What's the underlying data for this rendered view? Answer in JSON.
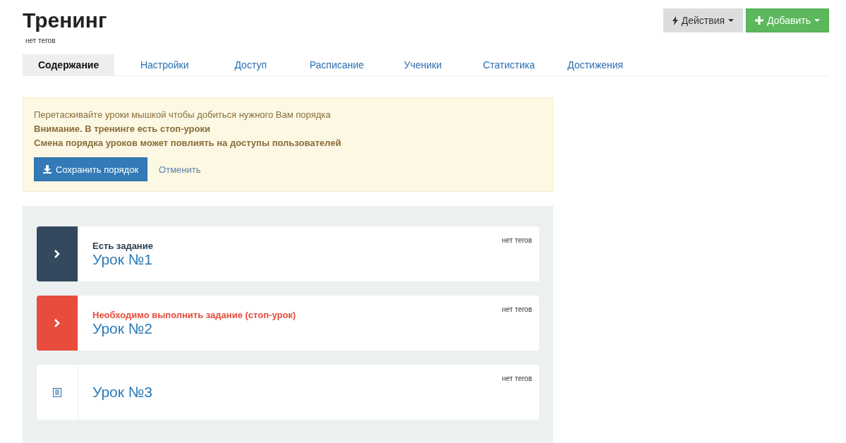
{
  "header": {
    "title": "Тренинг",
    "tags": "нет тегов",
    "actions": [
      {
        "kind": "actions",
        "label": "Действия"
      },
      {
        "kind": "add",
        "label": "Добавить"
      }
    ]
  },
  "tabs": [
    {
      "label": "Содержание",
      "selected": true
    },
    {
      "label": "Настройки",
      "selected": false
    },
    {
      "label": "Доступ",
      "selected": false
    },
    {
      "label": "Расписание",
      "selected": false
    },
    {
      "label": "Ученики",
      "selected": false
    },
    {
      "label": "Статистика",
      "selected": false
    },
    {
      "label": "Достижения",
      "selected": false
    }
  ],
  "notice": {
    "lines": [
      {
        "text": "Перетаскивайте уроки мышкой чтобы добиться нужного Вам порядка",
        "bold": false
      },
      {
        "text": "Внимание. В тренинге есть стоп-уроки",
        "bold": true
      },
      {
        "text": "Смена порядка уроков может повлиять на доступы пользователей",
        "bold": true
      }
    ],
    "save": "Сохранить порядок",
    "cancel": "Отменить"
  },
  "lessons": [
    {
      "kind": "task",
      "status": "Есть задание",
      "title": "Урок №1",
      "tags": "нет тегов"
    },
    {
      "kind": "stop",
      "status": "Необходимо выполнить задание (стоп-урок)",
      "title": "Урок №2",
      "tags": "нет тегов"
    },
    {
      "kind": "plain",
      "title": "Урок №3",
      "tags": "нет тегов"
    }
  ]
}
